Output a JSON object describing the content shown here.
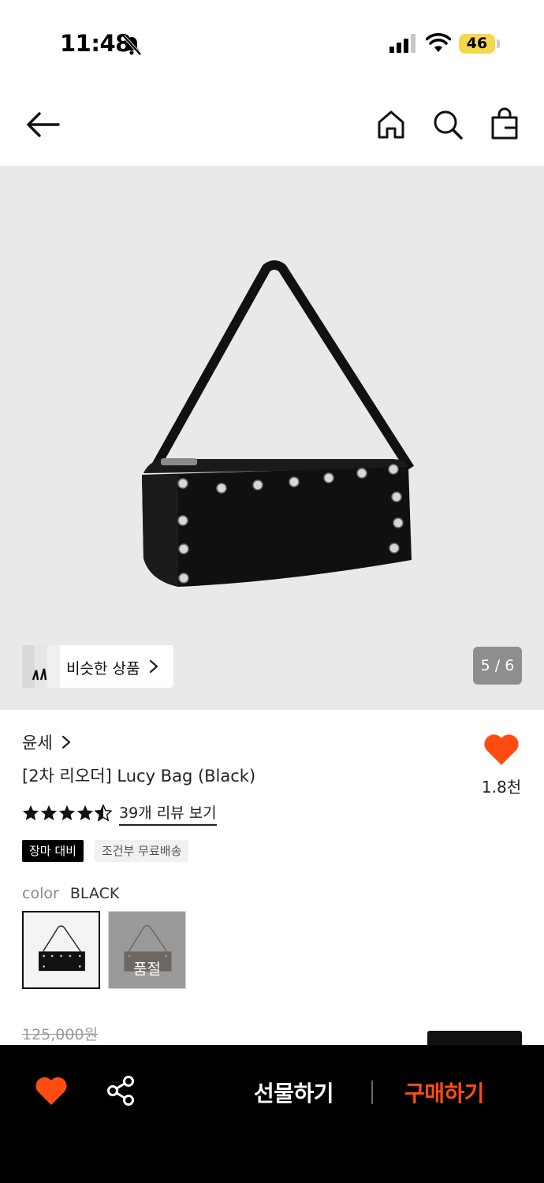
{
  "status_bar": {
    "time": "11:48",
    "battery": "46",
    "battery_color": "#f5d94a"
  },
  "nav": {
    "back_icon": "arrow-left-icon",
    "home_icon": "home-icon",
    "search_icon": "search-icon",
    "bag_icon": "shopping-bag-icon"
  },
  "gallery": {
    "background": "#e9e9eb",
    "similar_label": "비슷한 상품",
    "page_counter": "5 / 6"
  },
  "product": {
    "brand": "윤세",
    "title": "[2차 리오더] Lucy Bag (Black)",
    "like_count": "1.8천",
    "rating": 4.5,
    "rating_max": 5,
    "review_link": "39개 리뷰 보기",
    "tags": [
      "장마 대비",
      "조건부 무료배송"
    ],
    "color_label": "color",
    "color_value": "BLACK",
    "soldout_label": "품절",
    "original_price": "125,000원"
  },
  "colors": {
    "accent": "#ff4d12",
    "heart": "#ff4d12"
  },
  "bottom_bar": {
    "gift_label": "선물하기",
    "buy_label": "구매하기"
  }
}
